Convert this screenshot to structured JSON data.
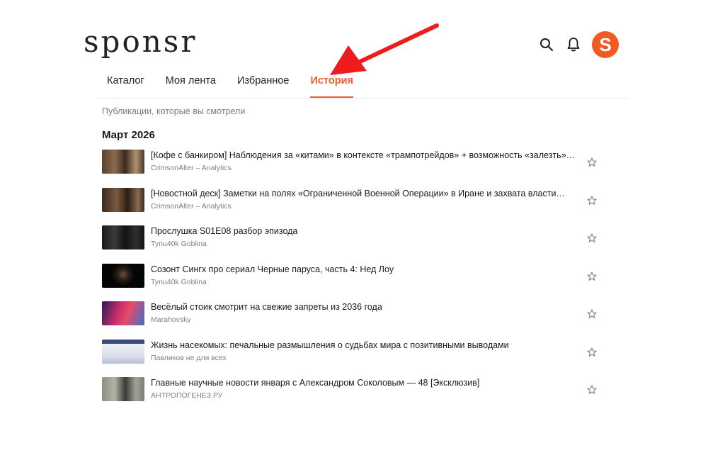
{
  "brand": {
    "logo_text": "sponsr",
    "accent_color": "#f15a24"
  },
  "header": {
    "search_icon": "search-icon",
    "notifications_icon": "bell-icon",
    "avatar_letter": "S"
  },
  "nav": {
    "tabs": [
      {
        "label": "Каталог",
        "active": false
      },
      {
        "label": "Моя лента",
        "active": false
      },
      {
        "label": "Избранное",
        "active": false
      },
      {
        "label": "История",
        "active": true
      }
    ]
  },
  "history": {
    "subtitle": "Публикации, которые вы смотрели",
    "month": "Март 2026",
    "items": [
      {
        "title": "[Кофе с банкиром] Наблюдения за «китами» в контексте «трампотрейдов» + возможность «залезть» в полезный…",
        "author": "CrimsonAlter – Analytics"
      },
      {
        "title": "[Новостной деск] Заметки на полях «Ограниченной Военной Операции» в Иране и захвата власти…",
        "author": "CrimsonAlter – Analytics"
      },
      {
        "title": "Прослушка S01E08 разбор эпизода",
        "author": "Tynu40k Goblina"
      },
      {
        "title": "Созонт Сингх про сериал Черные паруса, часть 4: Нед Лоу",
        "author": "Tynu40k Goblina"
      },
      {
        "title": "Весёлый стоик смотрит на свежие запреты из 2036 года",
        "author": "Marahovsky"
      },
      {
        "title": "Жизнь насекомых: печальные размышления о судьбах мира с позитивными выводами",
        "author": "Павликов не для всех"
      },
      {
        "title": "Главные научные новости января с Александром Соколовым — 48 [Эксклюзив]",
        "author": "АНТРОПОГЕНЕЗ.РУ"
      }
    ]
  }
}
